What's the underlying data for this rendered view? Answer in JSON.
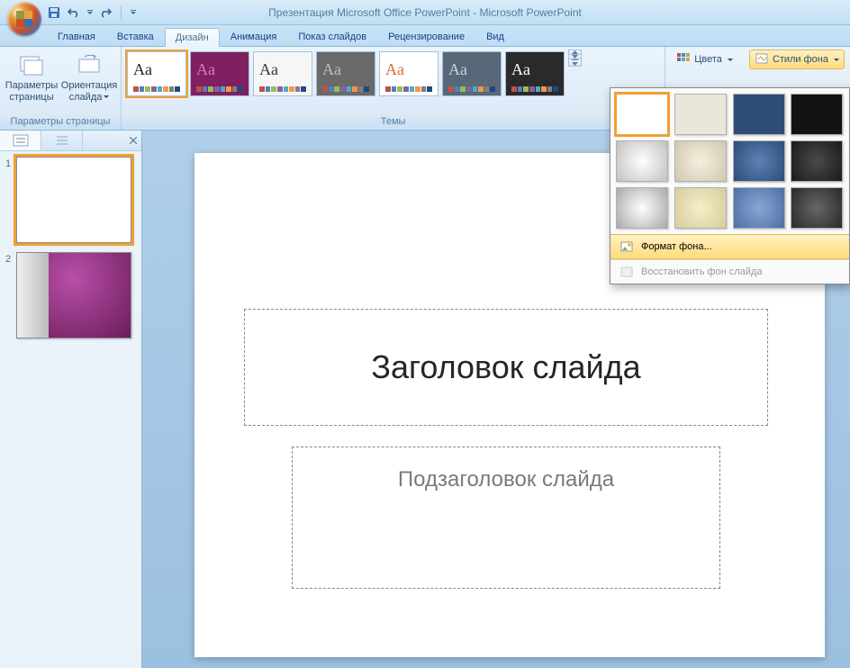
{
  "title": "Презентация Microsoft Office PowerPoint - Microsoft PowerPoint",
  "tabs": {
    "home": "Главная",
    "insert": "Вставка",
    "design": "Дизайн",
    "animation": "Анимация",
    "slideshow": "Показ слайдов",
    "review": "Рецензирование",
    "view": "Вид"
  },
  "ribbon": {
    "page_setup_group": "Параметры страницы",
    "page_setup_btn": "Параметры страницы",
    "orientation_btn": "Ориентация слайда",
    "themes_group": "Темы",
    "colors_btn": "Цвета",
    "bg_styles_btn": "Стили фона"
  },
  "themes": [
    {
      "bg": "#ffffff",
      "fg": "#262626",
      "id": "office"
    },
    {
      "bg": "#802060",
      "fg": "#d679c0",
      "id": "purple"
    },
    {
      "bg": "#f6f6f6",
      "fg": "#3a3a3a",
      "id": "gray1"
    },
    {
      "bg": "#6a6a6a",
      "fg": "#bcbcbc",
      "id": "gray2"
    },
    {
      "bg": "#ffffff",
      "fg": "#e06a2f",
      "id": "orange"
    },
    {
      "bg": "#586878",
      "fg": "#c9d4dd",
      "id": "slate"
    },
    {
      "bg": "#2a2a2a",
      "fg": "#ffffff",
      "id": "dark"
    }
  ],
  "bg_styles": {
    "row1": [
      "#ffffff",
      "#eae6d9",
      "#2d4c78",
      "#121212"
    ],
    "row2": [
      "radial-gradient(circle at 50% 50%, #ffffff, #c0c0c0)",
      "radial-gradient(circle at 50% 50%, #f5f0df, #cfc8b0)",
      "radial-gradient(circle at 50% 50%, #5d81b5, #2d4c78)",
      "radial-gradient(circle at 50% 50%, #4a4a4a, #1a1a1a)"
    ],
    "row3": [
      "radial-gradient(circle at 50% 50%, #ffffff, #a8a8a8)",
      "radial-gradient(circle at 50% 50%, #f5eec8, #d6cd9c)",
      "radial-gradient(circle at 50% 50%, #8ba5d0, #4d6ea6)",
      "radial-gradient(circle at 50% 50%, #666, #2a2a2a)"
    ],
    "format_bg": "Формат фона...",
    "reset_bg": "Восстановить фон слайда"
  },
  "slides": {
    "s1": "1",
    "s2": "2"
  },
  "placeholders": {
    "title": "Заголовок слайда",
    "subtitle": "Подзаголовок слайда"
  }
}
